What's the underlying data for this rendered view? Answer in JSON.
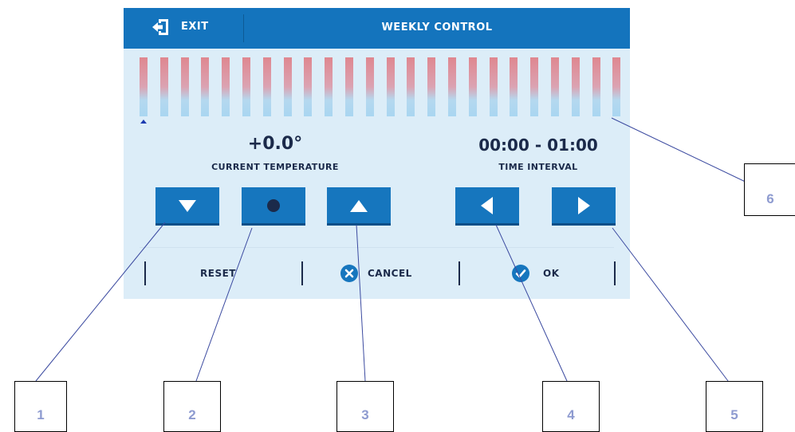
{
  "header": {
    "exit_label": "EXIT",
    "title": "WEEKLY CONTROL"
  },
  "schedule": {
    "bar_count": 24,
    "selected_hour_index": 0,
    "colors": {
      "warm": "#df8790",
      "cool": "#a9d6f1"
    }
  },
  "temperature": {
    "value": "+0.0°",
    "label": "CURRENT TEMPERATURE"
  },
  "interval": {
    "value": "00:00 - 01:00",
    "label": "TIME INTERVAL"
  },
  "controls": {
    "decrease": "triangle-down-icon",
    "select": "dot-icon",
    "increase": "triangle-up-icon",
    "previous": "triangle-left-icon",
    "next": "triangle-right-icon"
  },
  "footer": {
    "reset_label": "RESET",
    "cancel_label": "CANCEL",
    "ok_label": "OK"
  },
  "callouts": [
    "1",
    "2",
    "3",
    "4",
    "5",
    "6"
  ],
  "colors": {
    "accent": "#1474bd",
    "button": "#1676be",
    "panel": "#dcedf8",
    "text": "#1b2a4a"
  }
}
